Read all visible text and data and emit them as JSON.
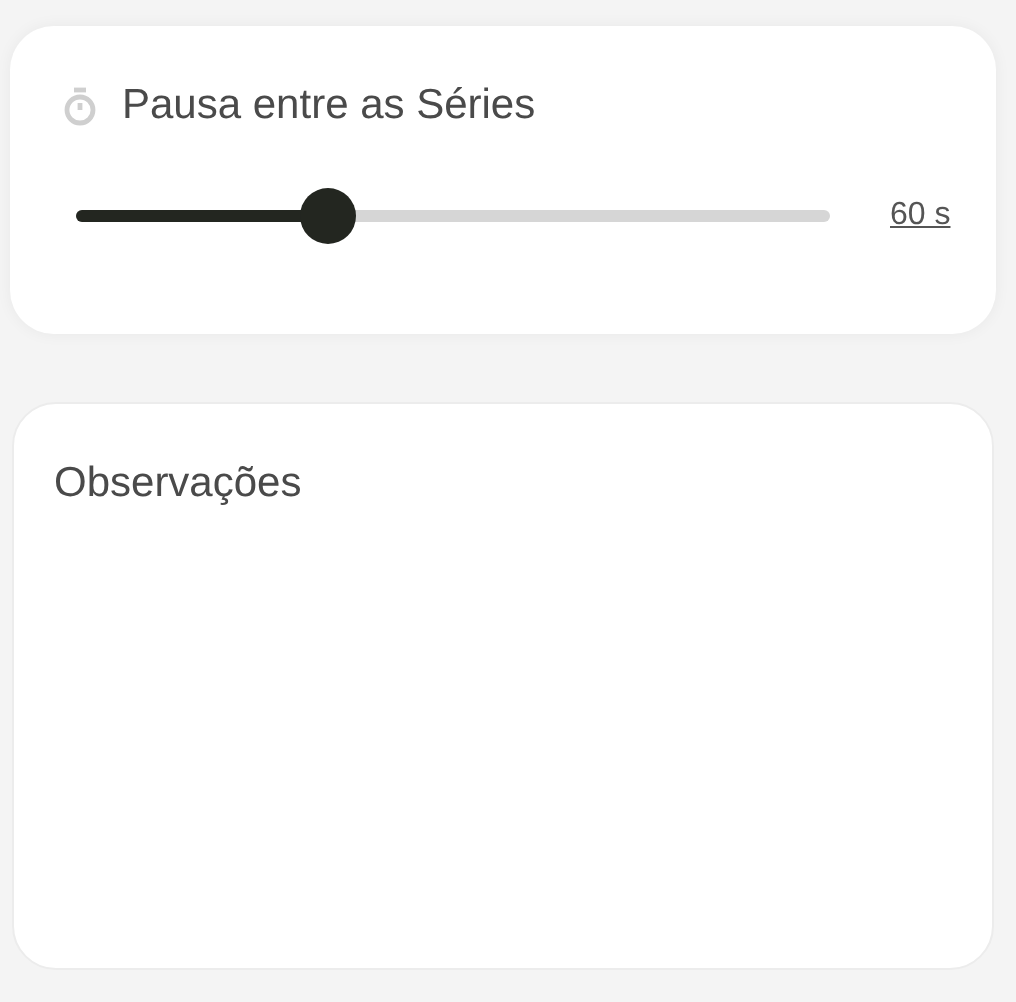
{
  "rest_card": {
    "title": "Pausa entre as Séries",
    "slider": {
      "level": 0.334,
      "reading": "60 s"
    }
  },
  "notes_card": {
    "title": "Observações"
  }
}
